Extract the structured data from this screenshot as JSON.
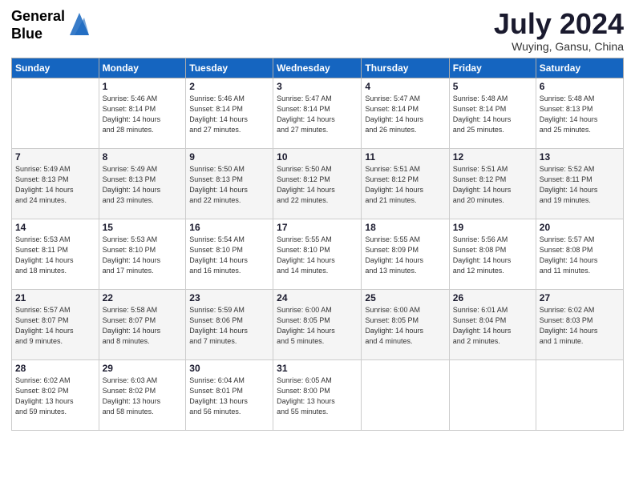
{
  "logo": {
    "line1": "General",
    "line2": "Blue"
  },
  "title": {
    "month_year": "July 2024",
    "location": "Wuying, Gansu, China"
  },
  "weekdays": [
    "Sunday",
    "Monday",
    "Tuesday",
    "Wednesday",
    "Thursday",
    "Friday",
    "Saturday"
  ],
  "weeks": [
    [
      {
        "day": "",
        "info": ""
      },
      {
        "day": "1",
        "info": "Sunrise: 5:46 AM\nSunset: 8:14 PM\nDaylight: 14 hours\nand 28 minutes."
      },
      {
        "day": "2",
        "info": "Sunrise: 5:46 AM\nSunset: 8:14 PM\nDaylight: 14 hours\nand 27 minutes."
      },
      {
        "day": "3",
        "info": "Sunrise: 5:47 AM\nSunset: 8:14 PM\nDaylight: 14 hours\nand 27 minutes."
      },
      {
        "day": "4",
        "info": "Sunrise: 5:47 AM\nSunset: 8:14 PM\nDaylight: 14 hours\nand 26 minutes."
      },
      {
        "day": "5",
        "info": "Sunrise: 5:48 AM\nSunset: 8:14 PM\nDaylight: 14 hours\nand 25 minutes."
      },
      {
        "day": "6",
        "info": "Sunrise: 5:48 AM\nSunset: 8:13 PM\nDaylight: 14 hours\nand 25 minutes."
      }
    ],
    [
      {
        "day": "7",
        "info": "Sunrise: 5:49 AM\nSunset: 8:13 PM\nDaylight: 14 hours\nand 24 minutes."
      },
      {
        "day": "8",
        "info": "Sunrise: 5:49 AM\nSunset: 8:13 PM\nDaylight: 14 hours\nand 23 minutes."
      },
      {
        "day": "9",
        "info": "Sunrise: 5:50 AM\nSunset: 8:13 PM\nDaylight: 14 hours\nand 22 minutes."
      },
      {
        "day": "10",
        "info": "Sunrise: 5:50 AM\nSunset: 8:12 PM\nDaylight: 14 hours\nand 22 minutes."
      },
      {
        "day": "11",
        "info": "Sunrise: 5:51 AM\nSunset: 8:12 PM\nDaylight: 14 hours\nand 21 minutes."
      },
      {
        "day": "12",
        "info": "Sunrise: 5:51 AM\nSunset: 8:12 PM\nDaylight: 14 hours\nand 20 minutes."
      },
      {
        "day": "13",
        "info": "Sunrise: 5:52 AM\nSunset: 8:11 PM\nDaylight: 14 hours\nand 19 minutes."
      }
    ],
    [
      {
        "day": "14",
        "info": "Sunrise: 5:53 AM\nSunset: 8:11 PM\nDaylight: 14 hours\nand 18 minutes."
      },
      {
        "day": "15",
        "info": "Sunrise: 5:53 AM\nSunset: 8:10 PM\nDaylight: 14 hours\nand 17 minutes."
      },
      {
        "day": "16",
        "info": "Sunrise: 5:54 AM\nSunset: 8:10 PM\nDaylight: 14 hours\nand 16 minutes."
      },
      {
        "day": "17",
        "info": "Sunrise: 5:55 AM\nSunset: 8:10 PM\nDaylight: 14 hours\nand 14 minutes."
      },
      {
        "day": "18",
        "info": "Sunrise: 5:55 AM\nSunset: 8:09 PM\nDaylight: 14 hours\nand 13 minutes."
      },
      {
        "day": "19",
        "info": "Sunrise: 5:56 AM\nSunset: 8:08 PM\nDaylight: 14 hours\nand 12 minutes."
      },
      {
        "day": "20",
        "info": "Sunrise: 5:57 AM\nSunset: 8:08 PM\nDaylight: 14 hours\nand 11 minutes."
      }
    ],
    [
      {
        "day": "21",
        "info": "Sunrise: 5:57 AM\nSunset: 8:07 PM\nDaylight: 14 hours\nand 9 minutes."
      },
      {
        "day": "22",
        "info": "Sunrise: 5:58 AM\nSunset: 8:07 PM\nDaylight: 14 hours\nand 8 minutes."
      },
      {
        "day": "23",
        "info": "Sunrise: 5:59 AM\nSunset: 8:06 PM\nDaylight: 14 hours\nand 7 minutes."
      },
      {
        "day": "24",
        "info": "Sunrise: 6:00 AM\nSunset: 8:05 PM\nDaylight: 14 hours\nand 5 minutes."
      },
      {
        "day": "25",
        "info": "Sunrise: 6:00 AM\nSunset: 8:05 PM\nDaylight: 14 hours\nand 4 minutes."
      },
      {
        "day": "26",
        "info": "Sunrise: 6:01 AM\nSunset: 8:04 PM\nDaylight: 14 hours\nand 2 minutes."
      },
      {
        "day": "27",
        "info": "Sunrise: 6:02 AM\nSunset: 8:03 PM\nDaylight: 14 hours\nand 1 minute."
      }
    ],
    [
      {
        "day": "28",
        "info": "Sunrise: 6:02 AM\nSunset: 8:02 PM\nDaylight: 13 hours\nand 59 minutes."
      },
      {
        "day": "29",
        "info": "Sunrise: 6:03 AM\nSunset: 8:02 PM\nDaylight: 13 hours\nand 58 minutes."
      },
      {
        "day": "30",
        "info": "Sunrise: 6:04 AM\nSunset: 8:01 PM\nDaylight: 13 hours\nand 56 minutes."
      },
      {
        "day": "31",
        "info": "Sunrise: 6:05 AM\nSunset: 8:00 PM\nDaylight: 13 hours\nand 55 minutes."
      },
      {
        "day": "",
        "info": ""
      },
      {
        "day": "",
        "info": ""
      },
      {
        "day": "",
        "info": ""
      }
    ]
  ]
}
